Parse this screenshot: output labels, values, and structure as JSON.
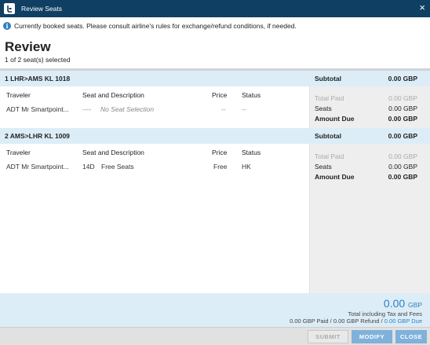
{
  "window": {
    "title": "Review Seats",
    "close_glyph": "×"
  },
  "info": {
    "icon_glyph": "i",
    "message": "Currently booked seats. Please consult airline's rules for exchange/refund conditions, if needed."
  },
  "review": {
    "heading": "Review",
    "selected_text": "1 of 2 seat(s) selected"
  },
  "columns": {
    "traveler": "Traveler",
    "seat": "Seat and Description",
    "price": "Price",
    "status": "Status"
  },
  "segments": [
    {
      "route": "1 LHR>AMS KL 1018",
      "subtotal_label": "Subtotal",
      "subtotal_value": "0.00 GBP",
      "row": {
        "traveler": "ADT Mr Smartpoint...",
        "seat": "----",
        "description": "No Seat Selection",
        "price": "--",
        "status": "--"
      },
      "summary": {
        "total_paid_label": "Total Paid",
        "total_paid_value": "0.00 GBP",
        "seats_label": "Seats",
        "seats_value": "0.00 GBP",
        "amount_due_label": "Amount Due",
        "amount_due_value": "0.00 GBP"
      }
    },
    {
      "route": "2 AMS>LHR KL 1009",
      "subtotal_label": "Subtotal",
      "subtotal_value": "0.00 GBP",
      "row": {
        "traveler": "ADT Mr Smartpoint...",
        "seat": "14D",
        "description": "Free Seats",
        "price": "Free",
        "status": "HK"
      },
      "summary": {
        "total_paid_label": "Total Paid",
        "total_paid_value": "0.00 GBP",
        "seats_label": "Seats",
        "seats_value": "0.00 GBP",
        "amount_due_label": "Amount Due",
        "amount_due_value": "0.00 GBP"
      }
    }
  ],
  "footer": {
    "total_amount": "0.00",
    "total_currency": "GBP",
    "including_text": "Total including Tax and Fees",
    "paid_text": "0.00 GBP Paid",
    "refund_text": "0.00 GBP Refund",
    "due_text": "0.00 GBP Due",
    "divider": "/"
  },
  "buttons": {
    "submit": "SUBMIT",
    "modify": "MODIFY",
    "close": "CLOSE"
  },
  "colors": {
    "title_bar": "#0f3f63",
    "accent": "#2f7fc1",
    "segment_bar": "#dcedf7",
    "button_active": "#7fb1da"
  }
}
